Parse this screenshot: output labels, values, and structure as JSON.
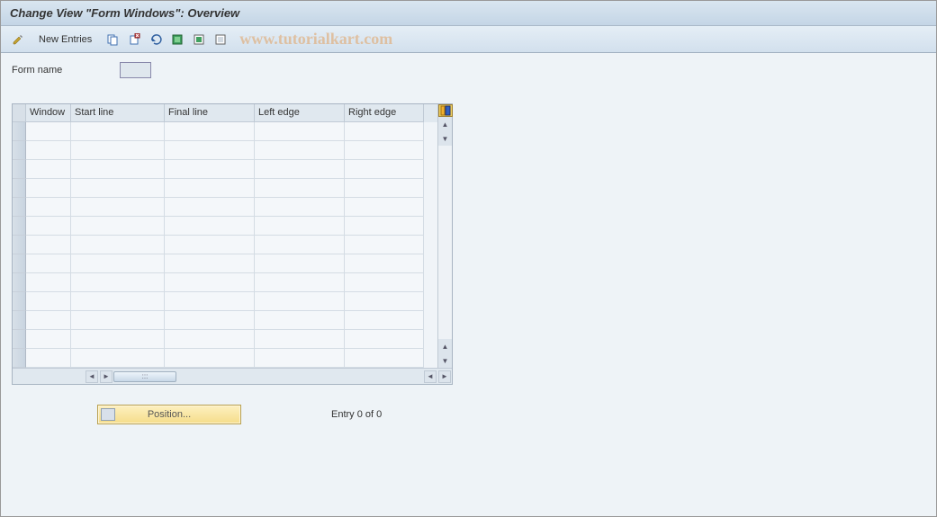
{
  "title": "Change View \"Form Windows\": Overview",
  "toolbar": {
    "new_entries_label": "New Entries"
  },
  "watermark": "www.tutorialkart.com",
  "form": {
    "name_label": "Form name",
    "name_value": ""
  },
  "table": {
    "headers": {
      "window": "Window",
      "start_line": "Start line",
      "final_line": "Final line",
      "left_edge": "Left edge",
      "right_edge": "Right edge"
    },
    "rows": [
      {
        "window": "",
        "start_line": "",
        "final_line": "",
        "left_edge": "",
        "right_edge": ""
      },
      {
        "window": "",
        "start_line": "",
        "final_line": "",
        "left_edge": "",
        "right_edge": ""
      },
      {
        "window": "",
        "start_line": "",
        "final_line": "",
        "left_edge": "",
        "right_edge": ""
      },
      {
        "window": "",
        "start_line": "",
        "final_line": "",
        "left_edge": "",
        "right_edge": ""
      },
      {
        "window": "",
        "start_line": "",
        "final_line": "",
        "left_edge": "",
        "right_edge": ""
      },
      {
        "window": "",
        "start_line": "",
        "final_line": "",
        "left_edge": "",
        "right_edge": ""
      },
      {
        "window": "",
        "start_line": "",
        "final_line": "",
        "left_edge": "",
        "right_edge": ""
      },
      {
        "window": "",
        "start_line": "",
        "final_line": "",
        "left_edge": "",
        "right_edge": ""
      },
      {
        "window": "",
        "start_line": "",
        "final_line": "",
        "left_edge": "",
        "right_edge": ""
      },
      {
        "window": "",
        "start_line": "",
        "final_line": "",
        "left_edge": "",
        "right_edge": ""
      },
      {
        "window": "",
        "start_line": "",
        "final_line": "",
        "left_edge": "",
        "right_edge": ""
      },
      {
        "window": "",
        "start_line": "",
        "final_line": "",
        "left_edge": "",
        "right_edge": ""
      },
      {
        "window": "",
        "start_line": "",
        "final_line": "",
        "left_edge": "",
        "right_edge": ""
      }
    ]
  },
  "footer": {
    "position_label": "Position...",
    "entry_status": "Entry 0 of 0"
  }
}
